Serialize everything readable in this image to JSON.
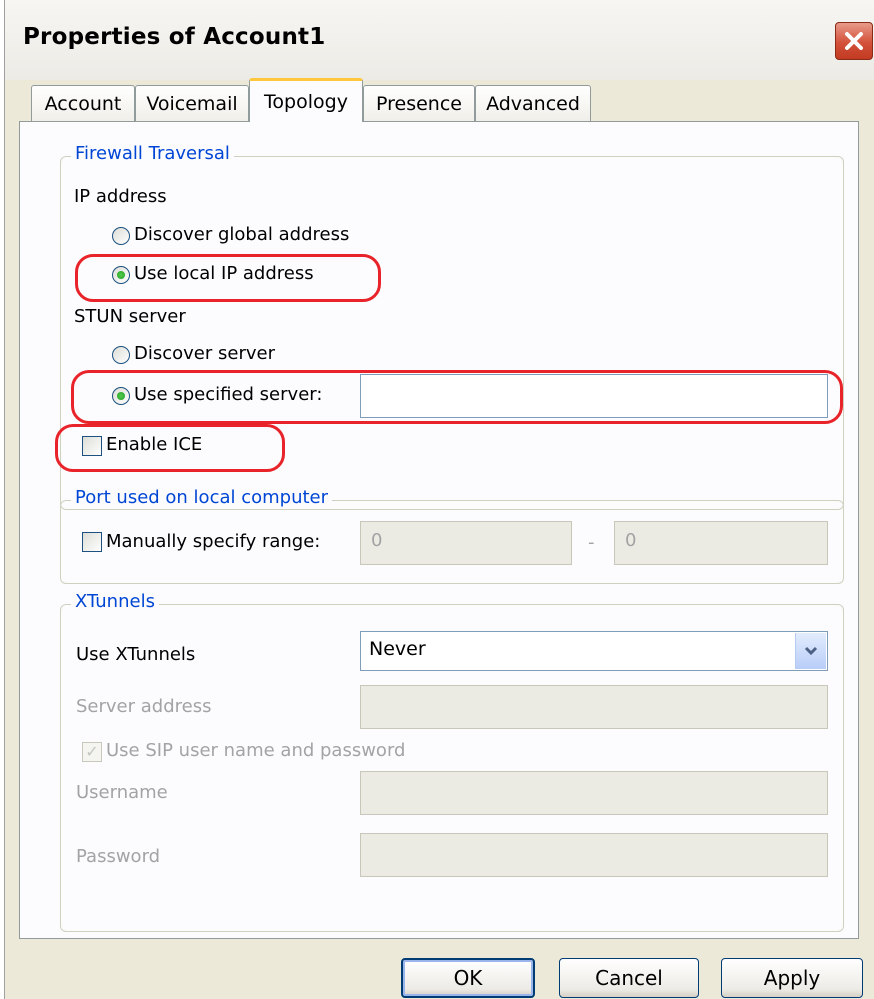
{
  "window": {
    "title": "Properties of Account1"
  },
  "tabs": [
    "Account",
    "Voicemail",
    "Topology",
    "Presence",
    "Advanced"
  ],
  "firewall": {
    "legend": "Firewall Traversal",
    "ip_address_label": "IP address",
    "ip_options": [
      "Discover global address",
      "Use local IP address"
    ],
    "ip_selected": "Use local IP address",
    "stun_label": "STUN server",
    "stun_options": [
      "Discover server",
      "Use specified server:"
    ],
    "stun_selected": "Use specified server:",
    "stun_server_value": "",
    "enable_ice_label": "Enable ICE",
    "enable_ice_checked": false
  },
  "port": {
    "legend": "Port used on local computer",
    "manual_label": "Manually specify range:",
    "manual_checked": false,
    "range_from": "0",
    "range_separator": "-",
    "range_to": "0"
  },
  "xtunnels": {
    "legend": "XTunnels",
    "use_label": "Use XTunnels",
    "use_value": "Never",
    "server_address_label": "Server address",
    "server_address_value": "",
    "use_sip_label": "Use SIP user name and password",
    "use_sip_checked": true,
    "username_label": "Username",
    "username_value": "",
    "password_label": "Password",
    "password_value": ""
  },
  "buttons": {
    "ok": "OK",
    "cancel": "Cancel",
    "apply": "Apply"
  },
  "colors": {
    "highlight": "#e8242a",
    "legend_text": "#0046d5",
    "active_tab_accent": "#ffc83c"
  },
  "icons": {
    "close": "close-icon",
    "dropdown": "chevron-down-icon",
    "check": "check-icon"
  }
}
